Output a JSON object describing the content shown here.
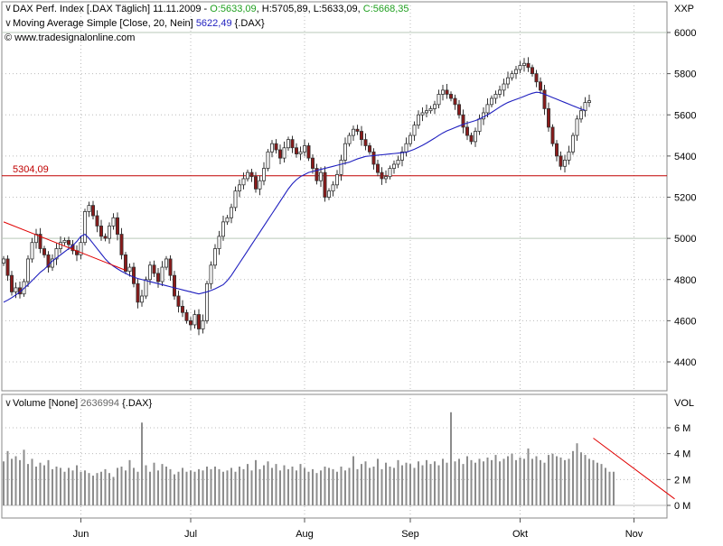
{
  "header": {
    "instrument": "DAX Perf. Index [.DAX Täglich] 11.11.2009 -",
    "open": "O:5633,09",
    "high": "H:5705,89",
    "low": "L:5633,09",
    "close": "C:5668,35",
    "ma_label": "Moving Average Simple [Close, 20, Nein]",
    "ma_value": "5622,49",
    "ma_symbol": "{.DAX}",
    "source": "© www.tradesignalonline.com",
    "corner": "XXP"
  },
  "volume_header": {
    "label": "Volume [None]",
    "value": "2636994",
    "symbol": "{.DAX}",
    "axis_title": "VOL"
  },
  "colors": {
    "up": "#ffffff",
    "down": "#8b1a1a",
    "wick": "#333333",
    "ma": "#1f1fbf",
    "level": "#c00000",
    "trend": "#e00000",
    "volume": "#8c8c8c",
    "ohlc_value": "#20a020"
  },
  "chart_data": [
    {
      "type": "candlestick",
      "y_ticks": [
        "6000",
        "5800",
        "5600",
        "5400",
        "5200",
        "5000",
        "4800",
        "4600",
        "4400"
      ],
      "ylim": [
        4300,
        6050
      ],
      "months": [
        {
          "label": "Jun",
          "index": 19
        },
        {
          "label": "Jul",
          "index": 46
        },
        {
          "label": "Aug",
          "index": 74
        },
        {
          "label": "Sep",
          "index": 100
        },
        {
          "label": "Okt",
          "index": 127
        },
        {
          "label": "Nov",
          "index": 155
        }
      ],
      "horizontal_level": {
        "value": 5304.09,
        "label": "5304,09"
      },
      "trendline": {
        "from": {
          "index": 0,
          "value": 5080
        },
        "to": {
          "index": 30,
          "value": 4845
        }
      },
      "closes": [
        4900,
        4820,
        4740,
        4760,
        4730,
        4790,
        4900,
        4980,
        5020,
        4950,
        4920,
        4860,
        4900,
        4950,
        4980,
        4990,
        4970,
        4940,
        4920,
        4980,
        5130,
        5160,
        5110,
        5060,
        5010,
        5000,
        5060,
        5100,
        5020,
        4920,
        4840,
        4860,
        4780,
        4690,
        4720,
        4800,
        4870,
        4830,
        4790,
        4860,
        4900,
        4820,
        4720,
        4670,
        4640,
        4600,
        4580,
        4630,
        4560,
        4600,
        4780,
        4870,
        4950,
        5010,
        5080,
        5100,
        5150,
        5230,
        5260,
        5290,
        5320,
        5300,
        5240,
        5280,
        5340,
        5420,
        5460,
        5430,
        5390,
        5440,
        5480,
        5440,
        5410,
        5420,
        5450,
        5390,
        5340,
        5280,
        5320,
        5200,
        5230,
        5260,
        5310,
        5380,
        5460,
        5500,
        5530,
        5520,
        5480,
        5450,
        5420,
        5360,
        5320,
        5290,
        5300,
        5340,
        5360,
        5380,
        5420,
        5460,
        5500,
        5550,
        5600,
        5610,
        5620,
        5630,
        5650,
        5700,
        5720,
        5700,
        5680,
        5650,
        5600,
        5540,
        5500,
        5470,
        5520,
        5580,
        5610,
        5650,
        5680,
        5700,
        5720,
        5750,
        5780,
        5800,
        5820,
        5840,
        5850,
        5830,
        5800,
        5760,
        5720,
        5630,
        5540,
        5460,
        5400,
        5350,
        5380,
        5420,
        5500,
        5580,
        5620,
        5660,
        5668.35
      ],
      "ma20": [
        4690,
        4700,
        4712,
        4725,
        4740,
        4757,
        4775,
        4795,
        4815,
        4835,
        4850,
        4870,
        4890,
        4905,
        4920,
        4935,
        4950,
        4965,
        4985,
        5010,
        5020,
        5000,
        4975,
        4950,
        4925,
        4900,
        4880,
        4865,
        4852,
        4840,
        4830,
        4820,
        4812,
        4805,
        4800,
        4795,
        4790,
        4785,
        4780,
        4775,
        4770,
        4765,
        4760,
        4755,
        4750,
        4745,
        4740,
        4735,
        4730,
        4735,
        4740,
        4747,
        4755,
        4765,
        4775,
        4795,
        4820,
        4850,
        4880,
        4910,
        4940,
        4970,
        5000,
        5030,
        5060,
        5090,
        5120,
        5150,
        5180,
        5210,
        5240,
        5265,
        5285,
        5300,
        5310,
        5320,
        5325,
        5330,
        5335,
        5340,
        5345,
        5350,
        5355,
        5360,
        5365,
        5370,
        5378,
        5386,
        5392,
        5398,
        5400,
        5402,
        5404,
        5406,
        5408,
        5410,
        5412,
        5414,
        5416,
        5418,
        5425,
        5433,
        5442,
        5452,
        5463,
        5475,
        5487,
        5500,
        5512,
        5522,
        5530,
        5538,
        5546,
        5554,
        5560,
        5566,
        5572,
        5580,
        5590,
        5600,
        5612,
        5625,
        5638,
        5650,
        5660,
        5668,
        5675,
        5682,
        5690,
        5698,
        5705,
        5710,
        5708,
        5700,
        5692,
        5684,
        5676,
        5668,
        5660,
        5652,
        5644,
        5636,
        5628,
        5622.49
      ],
      "volume": {
        "y_ticks": [
          "6 M",
          "4 M",
          "2 M",
          "0 M"
        ],
        "ylim": [
          0,
          7
        ],
        "values": [
          3.4,
          4.2,
          3.6,
          3.8,
          3.5,
          4.3,
          3.2,
          3.6,
          3.0,
          3.3,
          3.1,
          3.5,
          2.8,
          3.0,
          2.9,
          2.6,
          2.9,
          2.7,
          3.1,
          2.6,
          2.7,
          2.5,
          2.3,
          2.5,
          2.6,
          2.8,
          2.5,
          2.2,
          2.9,
          3.0,
          2.7,
          3.5,
          2.9,
          2.6,
          6.4,
          3.1,
          2.6,
          3.3,
          2.7,
          3.2,
          3.0,
          2.8,
          2.4,
          2.6,
          2.9,
          2.6,
          2.7,
          2.6,
          2.8,
          2.7,
          3.0,
          2.8,
          3.0,
          2.8,
          2.6,
          2.7,
          2.9,
          2.6,
          3.0,
          2.8,
          3.2,
          2.7,
          3.5,
          2.8,
          3.1,
          3.4,
          2.9,
          3.2,
          2.7,
          3.1,
          2.8,
          3.0,
          2.7,
          3.2,
          2.9,
          2.6,
          2.8,
          2.5,
          2.7,
          3.0,
          2.9,
          2.8,
          2.6,
          3.0,
          2.7,
          2.9,
          3.8,
          2.8,
          3.2,
          3.4,
          2.9,
          3.0,
          3.6,
          2.8,
          3.3,
          3.0,
          2.9,
          3.5,
          3.1,
          3.3,
          3.2,
          2.9,
          3.4,
          3.1,
          3.5,
          3.2,
          3.4,
          3.1,
          3.6,
          3.3,
          7.2,
          3.4,
          3.6,
          3.2,
          3.8,
          3.5,
          3.3,
          3.6,
          3.4,
          3.7,
          3.5,
          3.9,
          3.4,
          3.6,
          3.8,
          4.0,
          3.5,
          3.7,
          3.6,
          4.4,
          3.6,
          3.8,
          3.5,
          3.3,
          3.9,
          4.0,
          3.8,
          3.7,
          3.5,
          3.6,
          4.2,
          4.8,
          4.1,
          3.9,
          3.6,
          3.5,
          3.3,
          3.2,
          2.9,
          2.6,
          2.6
        ],
        "trendline": {
          "from": {
            "index": 145,
            "value": 5.2
          },
          "to": {
            "index": 165,
            "value": 0.5
          }
        }
      }
    }
  ]
}
